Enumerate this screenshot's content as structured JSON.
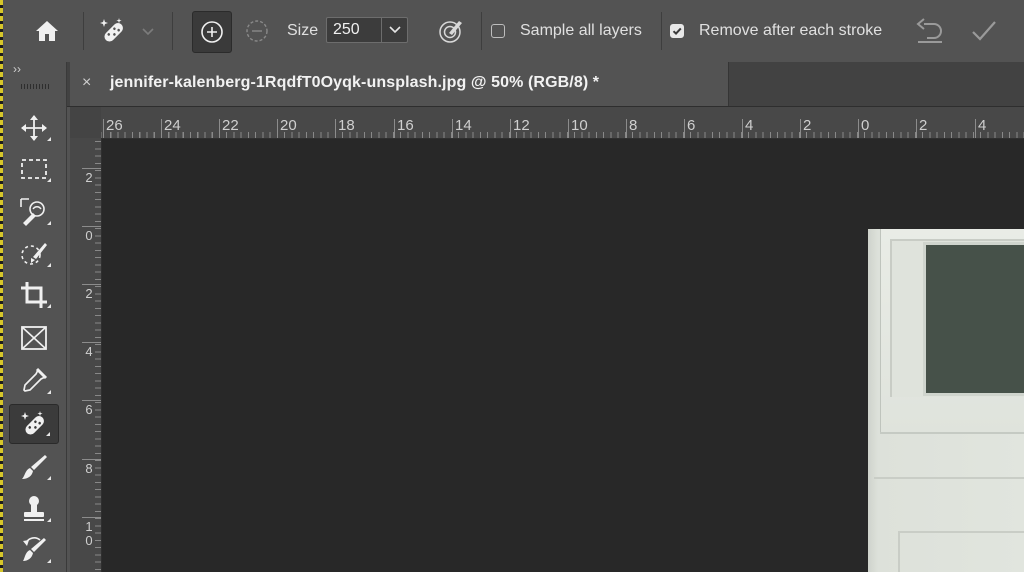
{
  "options_bar": {
    "home_icon": "home-icon",
    "tool_icon": "spot-healing-brush-icon",
    "mode_add_icon": "add-circle-icon",
    "mode_subtract_icon": "subtract-circle-icon",
    "size_label": "Size",
    "size_value": "250",
    "pressure_icon": "pen-pressure-icon",
    "sample_all_layers": {
      "label": "Sample all layers",
      "checked": false
    },
    "remove_after_stroke": {
      "label": "Remove after each stroke",
      "checked": true
    },
    "undo_icon": "undo-icon",
    "commit_icon": "checkmark-icon"
  },
  "toolbar": {
    "collapse_label": "››",
    "tools": [
      {
        "name": "move-tool",
        "icon": "move-icon"
      },
      {
        "name": "marquee-tool",
        "icon": "rectangular-marquee-icon"
      },
      {
        "name": "object-selection-tool",
        "icon": "object-selection-icon"
      },
      {
        "name": "quick-selection-tool",
        "icon": "quick-selection-icon"
      },
      {
        "name": "crop-tool",
        "icon": "crop-icon"
      },
      {
        "name": "frame-tool",
        "icon": "frame-icon"
      },
      {
        "name": "eyedropper-tool",
        "icon": "eyedropper-icon"
      },
      {
        "name": "spot-healing-tool",
        "icon": "spot-healing-brush-icon",
        "active": true
      },
      {
        "name": "brush-tool",
        "icon": "brush-icon"
      },
      {
        "name": "clone-stamp-tool",
        "icon": "clone-stamp-icon"
      },
      {
        "name": "history-brush-tool",
        "icon": "history-brush-icon"
      }
    ]
  },
  "document_tab": {
    "close_label": "×",
    "title": "jennifer-kalenberg-1RqdfT0Oyqk-unsplash.jpg @ 50% (RGB/8) *"
  },
  "rulers": {
    "horizontal_labels": [
      "26",
      "24",
      "22",
      "20",
      "18",
      "16",
      "14",
      "12",
      "10",
      "8",
      "6",
      "4",
      "2",
      "0",
      "2",
      "4"
    ],
    "vertical_labels": [
      "2",
      "0",
      "2",
      "4",
      "6",
      "8",
      "1\n0"
    ]
  },
  "colors": {
    "ui_background": "#535353",
    "canvas_pasteboard": "#282828",
    "accent_yellow": "#d6c62a"
  }
}
